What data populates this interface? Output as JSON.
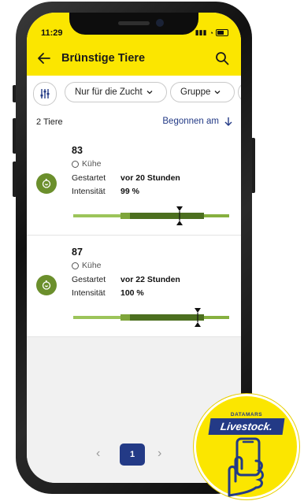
{
  "status_bar": {
    "time": "11:29"
  },
  "header": {
    "title": "Brünstige Tiere"
  },
  "filters": {
    "chips": [
      {
        "label": "Nur für die Zucht"
      },
      {
        "label": "Gruppe"
      }
    ]
  },
  "list_header": {
    "count": "2 Tiere",
    "sort_label": "Begonnen am"
  },
  "cards": [
    {
      "number": "83",
      "group": "Kühe",
      "started_label": "Gestartet",
      "started_value": "vor 20 Stunden",
      "intensity_label": "Intensität",
      "intensity_value": "99 %"
    },
    {
      "number": "87",
      "group": "Kühe",
      "started_label": "Gestartet",
      "started_value": "vor 22 Stunden",
      "intensity_label": "Intensität",
      "intensity_value": "100 %"
    }
  ],
  "pagination": {
    "current_page": "1"
  },
  "brand": {
    "tagline": "DATAMARS",
    "name": "Livestock."
  },
  "colors": {
    "accent_yellow": "#fbe600",
    "navy": "#233a86",
    "green_dark": "#4c6f1f",
    "green_mid": "#7ea53a",
    "green_light": "#9cc45a"
  }
}
